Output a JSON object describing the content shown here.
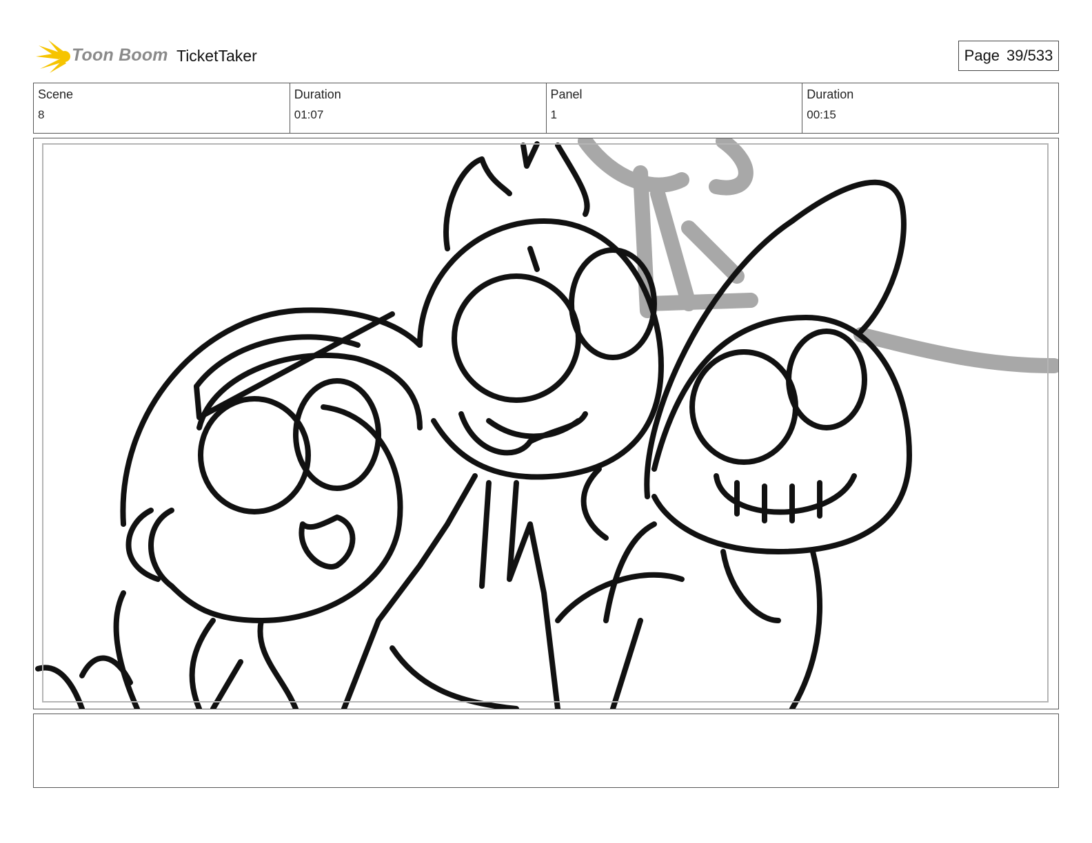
{
  "header": {
    "logo_text": "Toon Boom",
    "project": "TicketTaker",
    "page_label": "Page",
    "page_value": "39/533"
  },
  "info": {
    "scene_label": "Scene",
    "scene_value": "8",
    "scene_duration_label": "Duration",
    "scene_duration_value": "01:07",
    "panel_label": "Panel",
    "panel_value": "1",
    "panel_duration_label": "Duration",
    "panel_duration_value": "00:15"
  },
  "notes": {
    "text": ""
  }
}
